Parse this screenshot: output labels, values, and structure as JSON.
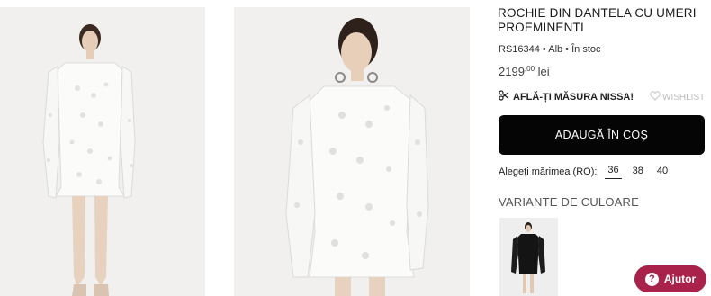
{
  "product": {
    "title": "ROCHIE DIN DANTELA CU UMERI PROEMINENTI",
    "meta": "RS16344 • Alb • În stoc",
    "price_main": "2199",
    "price_cents": ",00",
    "currency": "lei",
    "measure_link": "AFLĂ-ȚI MĂSURA NISSA!",
    "wishlist": "WISHLIST",
    "add_to_cart": "ADAUGĂ ÎN COȘ",
    "size_label": "Alegeți mărimea (RO):",
    "sizes": [
      "36",
      "38",
      "40"
    ],
    "selected_size": "36",
    "variants_heading": "VARIANTE DE CULOARE"
  },
  "help": {
    "label": "Ajutor"
  },
  "icons": {
    "measure": "scissors-icon",
    "wishlist": "heart-outline-icon",
    "help": "question-icon"
  },
  "colors": {
    "cta_bg": "#050505",
    "help_bg": "#a8224b",
    "photo_bg": "#f1f0ef"
  }
}
